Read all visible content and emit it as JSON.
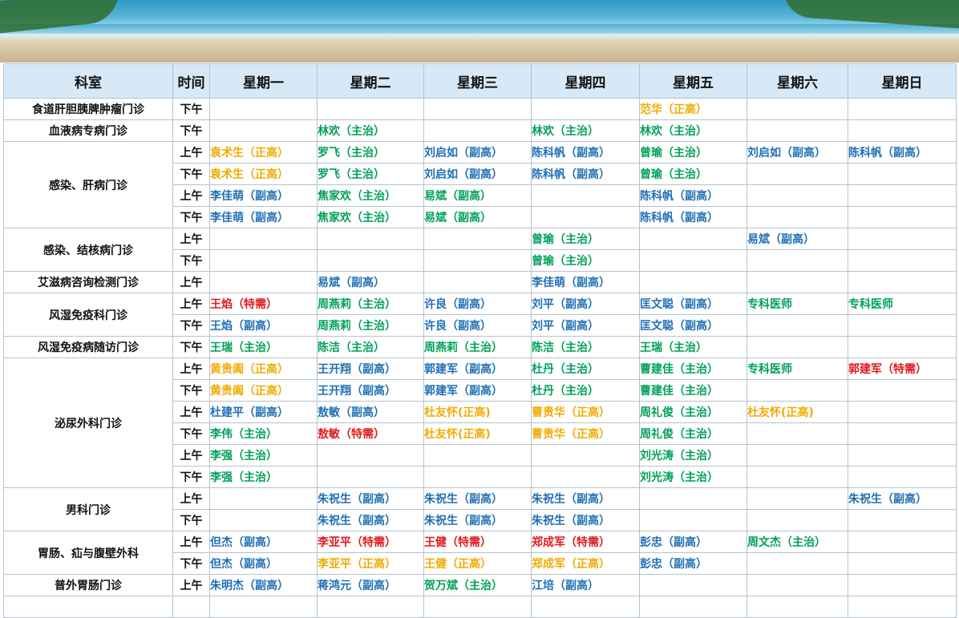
{
  "headers": [
    "科室",
    "时间",
    "星期一",
    "星期二",
    "星期三",
    "星期四",
    "星期五",
    "星期六",
    "星期日"
  ],
  "colors": {
    "green": "#00a05a",
    "blue": "#1f6fb5",
    "orange": "#f0ab00",
    "red": "#e0191e"
  },
  "rows": [
    {
      "dept": "食道肝胆胰脾肿瘤门诊",
      "span": 1,
      "period": "下午",
      "cells": [
        null,
        null,
        null,
        null,
        [
          "范华（正高）",
          "orange"
        ],
        null,
        null
      ]
    },
    {
      "dept": "血液病专病门诊",
      "span": 1,
      "period": "下午",
      "cells": [
        null,
        [
          "林欢（主治）",
          "green"
        ],
        null,
        [
          "林欢（主治）",
          "green"
        ],
        [
          "林欢（主治）",
          "green"
        ],
        null,
        null
      ]
    },
    {
      "dept": "感染、肝病门诊",
      "span": 4,
      "period": "上午",
      "cells": [
        [
          "袁术生（正高）",
          "orange"
        ],
        [
          "罗飞（主治）",
          "green"
        ],
        [
          "刘启如（副高）",
          "blue"
        ],
        [
          "陈科帆（副高）",
          "blue"
        ],
        [
          "曾瑜（主治）",
          "green"
        ],
        [
          "刘启如（副高）",
          "blue"
        ],
        [
          "陈科帆（副高）",
          "blue"
        ]
      ]
    },
    {
      "period": "下午",
      "cells": [
        [
          "袁术生（正高）",
          "orange"
        ],
        [
          "罗飞（主治）",
          "green"
        ],
        [
          "刘启如（副高）",
          "blue"
        ],
        [
          "陈科帆（副高）",
          "blue"
        ],
        [
          "曾瑜（主治）",
          "green"
        ],
        null,
        null
      ]
    },
    {
      "period": "上午",
      "cells": [
        [
          "李佳萌（副高）",
          "blue"
        ],
        [
          "焦家欢（主治）",
          "green"
        ],
        [
          "易斌（副高）",
          "green"
        ],
        null,
        [
          "陈科帆（副高）",
          "blue"
        ],
        null,
        null
      ]
    },
    {
      "period": "下午",
      "cells": [
        [
          "李佳萌（副高）",
          "blue"
        ],
        [
          "焦家欢（主治）",
          "green"
        ],
        [
          "易斌（副高）",
          "green"
        ],
        null,
        [
          "陈科帆（副高）",
          "blue"
        ],
        null,
        null
      ]
    },
    {
      "dept": "感染、结核病门诊",
      "span": 2,
      "period": "上午",
      "cells": [
        null,
        null,
        null,
        [
          "曾瑜（主治）",
          "green"
        ],
        null,
        [
          "易斌（副高）",
          "blue"
        ],
        null
      ]
    },
    {
      "period": "下午",
      "cells": [
        null,
        null,
        null,
        [
          "曾瑜（主治）",
          "green"
        ],
        null,
        null,
        null
      ]
    },
    {
      "dept": "艾滋病咨询检测门诊",
      "span": 1,
      "period": "上午",
      "cells": [
        null,
        [
          "易斌（副高）",
          "blue"
        ],
        null,
        [
          "李佳萌（副高）",
          "blue"
        ],
        null,
        null,
        null
      ]
    },
    {
      "dept": "风湿免疫科门诊",
      "span": 2,
      "period": "上午",
      "cells": [
        [
          "王焰（特需）",
          "red"
        ],
        [
          "周燕莉（主治）",
          "green"
        ],
        [
          "许良（副高）",
          "blue"
        ],
        [
          "刘平（副高）",
          "blue"
        ],
        [
          "匡文聪（副高）",
          "blue"
        ],
        [
          "专科医师",
          "green"
        ],
        [
          "专科医师",
          "green"
        ]
      ]
    },
    {
      "period": "下午",
      "cells": [
        [
          "王焰（副高）",
          "blue"
        ],
        [
          "周燕莉（主治）",
          "green"
        ],
        [
          "许良（副高）",
          "blue"
        ],
        [
          "刘平（副高）",
          "blue"
        ],
        [
          "匡文聪（副高）",
          "blue"
        ],
        null,
        null
      ]
    },
    {
      "dept": "风湿免疫病随访门诊",
      "span": 1,
      "period": "下午",
      "cells": [
        [
          "王瑞（主治）",
          "green"
        ],
        [
          "陈洁（主治）",
          "green"
        ],
        [
          "周燕莉（主治）",
          "green"
        ],
        [
          "陈洁（主治）",
          "green"
        ],
        [
          "王瑞（主治）",
          "green"
        ],
        null,
        null
      ]
    },
    {
      "dept": "泌尿外科门诊",
      "span": 6,
      "period": "上午",
      "cells": [
        [
          "黄贵阖（正高）",
          "orange"
        ],
        [
          "王开翔（副高）",
          "blue"
        ],
        [
          "郭建军（副高）",
          "blue"
        ],
        [
          "杜丹（主治）",
          "green"
        ],
        [
          "曹建佳（主治）",
          "green"
        ],
        [
          "专科医师",
          "green"
        ],
        [
          "郭建军（特需）",
          "red"
        ]
      ]
    },
    {
      "period": "下午",
      "cells": [
        [
          "黄贵阖（正高）",
          "orange"
        ],
        [
          "王开翔（副高）",
          "blue"
        ],
        [
          "郭建军（副高）",
          "blue"
        ],
        [
          "杜丹（主治）",
          "green"
        ],
        [
          "曹建佳（主治）",
          "green"
        ],
        null,
        null
      ]
    },
    {
      "period": "上午",
      "cells": [
        [
          "杜建平（副高）",
          "blue"
        ],
        [
          "敖敏（副高）",
          "blue"
        ],
        [
          "杜友怀(正高)",
          "orange"
        ],
        [
          "曹贵华（正高）",
          "orange"
        ],
        [
          "周礼俊（主治）",
          "green"
        ],
        [
          "杜友怀(正高)",
          "orange"
        ],
        null
      ]
    },
    {
      "period": "下午",
      "cells": [
        [
          "李伟（主治）",
          "green"
        ],
        [
          "敖敏（特需）",
          "red"
        ],
        [
          "杜友怀(正高)",
          "orange"
        ],
        [
          "曹贵华（正高）",
          "orange"
        ],
        [
          "周礼俊（主治）",
          "green"
        ],
        null,
        null
      ]
    },
    {
      "period": "上午",
      "cells": [
        [
          "李强（主治）",
          "green"
        ],
        null,
        null,
        null,
        [
          "刘光涛（主治）",
          "green"
        ],
        null,
        null
      ]
    },
    {
      "period": "下午",
      "cells": [
        [
          "李强（主治）",
          "green"
        ],
        null,
        null,
        null,
        [
          "刘光涛（主治）",
          "green"
        ],
        null,
        null
      ]
    },
    {
      "dept": "男科门诊",
      "span": 2,
      "period": "上午",
      "cells": [
        null,
        [
          "朱祝生（副高）",
          "blue"
        ],
        [
          "朱祝生（副高）",
          "blue"
        ],
        [
          "朱祝生（副高）",
          "blue"
        ],
        null,
        null,
        [
          "朱祝生（副高）",
          "blue"
        ]
      ]
    },
    {
      "period": "下午",
      "cells": [
        null,
        [
          "朱祝生（副高）",
          "blue"
        ],
        [
          "朱祝生（副高）",
          "blue"
        ],
        [
          "朱祝生（副高）",
          "blue"
        ],
        null,
        null,
        null
      ]
    },
    {
      "dept": "胃肠、疝与腹壁外科",
      "span": 2,
      "period": "上午",
      "cells": [
        [
          "但杰（副高）",
          "blue"
        ],
        [
          "李亚平（特需）",
          "red"
        ],
        [
          "王健（特需）",
          "red"
        ],
        [
          "郑成军（特需）",
          "red"
        ],
        [
          "彭忠（副高）",
          "blue"
        ],
        [
          "周文杰（主治）",
          "green"
        ],
        null
      ]
    },
    {
      "period": "下午",
      "cells": [
        [
          "但杰（副高）",
          "blue"
        ],
        [
          "李亚平（正高）",
          "orange"
        ],
        [
          "王健（正高）",
          "orange"
        ],
        [
          "郑成军（正高）",
          "orange"
        ],
        [
          "彭忠（副高）",
          "blue"
        ],
        null,
        null
      ]
    },
    {
      "dept": "普外胃肠门诊",
      "span": 1,
      "period": "上午",
      "cells": [
        [
          "朱明杰（副高）",
          "blue"
        ],
        [
          "蒋鸿元（副高）",
          "blue"
        ],
        [
          "贺万斌（主治）",
          "green"
        ],
        [
          "江培（副高）",
          "blue"
        ],
        null,
        null,
        null
      ]
    },
    {
      "period": "",
      "cells": [
        null,
        null,
        null,
        null,
        null,
        null,
        null
      ]
    }
  ]
}
